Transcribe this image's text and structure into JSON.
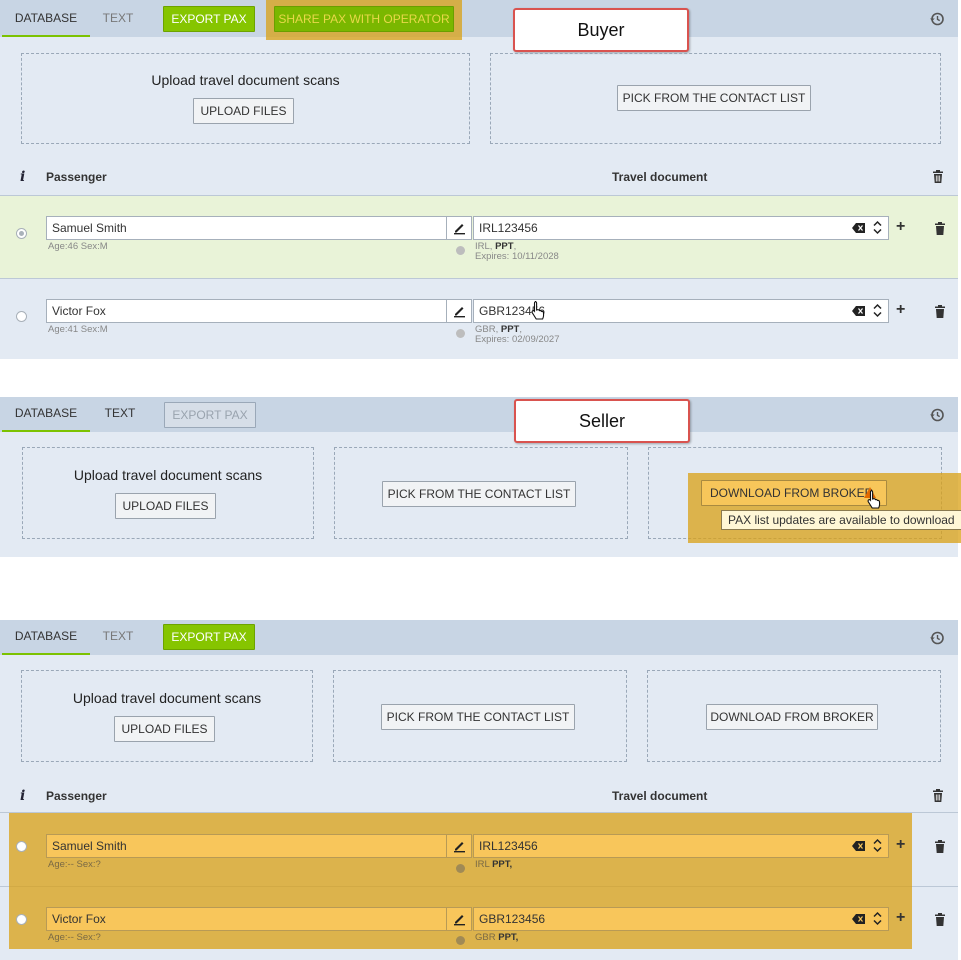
{
  "buyer": {
    "callout": "Buyer",
    "tabs": [
      "DATABASE",
      "TEXT"
    ],
    "export_label": "EXPORT PAX",
    "share_label": "SHARE PAX WITH OPERATOR",
    "upload_title": "Upload travel document scans",
    "upload_button": "UPLOAD FILES",
    "pick_button": "PICK FROM THE CONTACT LIST",
    "columns": {
      "passenger": "Passenger",
      "travel": "Travel document"
    },
    "rows": [
      {
        "name": "Samuel Smith",
        "meta": "Age:46 Sex:M",
        "doc": "IRL123456",
        "doc_country": "IRL,",
        "doc_type": "PPT",
        "doc_expiry": "Expires: 10/11/2028"
      },
      {
        "name": "Victor Fox",
        "meta": "Age:41 Sex:M",
        "doc": "GBR123456",
        "doc_country": "GBR,",
        "doc_type": "PPT",
        "doc_expiry": "Expires: 02/09/2027"
      }
    ]
  },
  "seller": {
    "callout": "Seller",
    "tabs": [
      "DATABASE",
      "TEXT"
    ],
    "export_label": "EXPORT PAX",
    "upload_title": "Upload travel document scans",
    "upload_button": "UPLOAD FILES",
    "pick_button": "PICK FROM THE CONTACT LIST",
    "download_button": "DOWNLOAD FROM BROKER",
    "tooltip": "PAX list updates are available to download"
  },
  "third": {
    "tabs": [
      "DATABASE",
      "TEXT"
    ],
    "export_label": "EXPORT PAX",
    "upload_title": "Upload travel document scans",
    "upload_button": "UPLOAD FILES",
    "pick_button": "PICK FROM THE CONTACT LIST",
    "download_button": "DOWNLOAD FROM BROKER",
    "columns": {
      "passenger": "Passenger",
      "travel": "Travel document"
    },
    "rows": [
      {
        "name": "Samuel Smith",
        "meta": "Age:-- Sex:?",
        "doc": "IRL123456",
        "doc_country": "IRL",
        "doc_type": "PPT,"
      },
      {
        "name": "Victor Fox",
        "meta": "Age:-- Sex:?",
        "doc": "GBR123456",
        "doc_country": "GBR",
        "doc_type": "PPT,"
      }
    ]
  },
  "colors": {
    "accent_green": "#86c500",
    "highlight_orange": "#d9a014",
    "callout_border": "#d9534f",
    "panel_bg": "#e3eaf3",
    "selected_row": "#e9f3d8"
  },
  "icons": [
    "history-icon",
    "info-icon",
    "edit-icon",
    "clear-icon",
    "spinner-icon",
    "plus-icon",
    "trash-icon",
    "hand-cursor-icon",
    "warning-icon"
  ]
}
